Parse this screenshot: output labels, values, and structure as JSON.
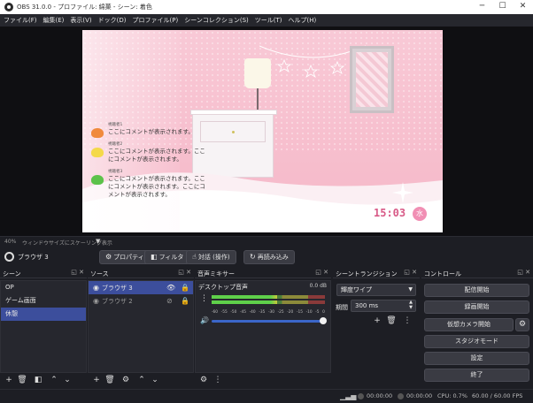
{
  "window": {
    "title": "OBS 31.0.0 - プロファイル: 綿菓 - シーン: 着色",
    "minimize": "─",
    "maximize": "☐",
    "close": "✕"
  },
  "menu": [
    "ファイル(F)",
    "編集(E)",
    "表示(V)",
    "ドック(D)",
    "プロファイル(P)",
    "シーンコレクション(S)",
    "ツール(T)",
    "ヘルプ(H)"
  ],
  "preview": {
    "comments": [
      {
        "name": "視聴者1",
        "msg": "ここにコメントが表示されます。",
        "color": "#f08a3c"
      },
      {
        "name": "視聴者2",
        "msg": "ここにコメントが表示されます。ここにコメントが表示されます。",
        "color": "#f4d94a"
      },
      {
        "name": "視聴者3",
        "msg": "ここにコメントが表示されます。ここにコメントが表示されます。ここにコメントが表示されます。",
        "color": "#5cc24a"
      }
    ],
    "clock": "15:03",
    "clock_day": "水"
  },
  "scale": {
    "zoom": "40%",
    "mode": "ウィンドウサイズにスケーリング表示",
    "caret": "▼"
  },
  "source_toolbar": {
    "source_name": "ブラウザ 3",
    "properties": "プロパティ",
    "filters": "フィルタ",
    "interact": "対話 (操作)",
    "refresh": "再読み込み"
  },
  "scenes": {
    "title": "シーン",
    "items": [
      {
        "label": "OP",
        "selected": false
      },
      {
        "label": "ゲーム画面",
        "selected": false
      },
      {
        "label": "休憩",
        "selected": true
      }
    ]
  },
  "sources": {
    "title": "ソース",
    "items": [
      {
        "label": "ブラウザ 3",
        "selected": true,
        "visible": true
      },
      {
        "label": "ブラウザ 2",
        "selected": false,
        "visible": false
      }
    ]
  },
  "mixer": {
    "title": "音声ミキサー",
    "track_name": "デスクトップ音声",
    "db_value": "0.0 dB",
    "meter_level": 0.58,
    "volume": 1.0,
    "ticks": [
      "-60",
      "-55",
      "-50",
      "-45",
      "-40",
      "-35",
      "-30",
      "-25",
      "-20",
      "-15",
      "-10",
      "-5",
      "0"
    ]
  },
  "transitions": {
    "title": "シーントランジション",
    "selected": "輝度ワイプ",
    "duration_label": "期間",
    "duration": "300 ms"
  },
  "controls": {
    "title": "コントロール",
    "start_stream": "配信開始",
    "start_record": "録画開始",
    "start_vcam": "仮想カメラ開始",
    "studio_mode": "スタジオモード",
    "settings": "設定",
    "exit": "終了"
  },
  "status": {
    "stream_time": "00:00:00",
    "record_time": "00:00:00",
    "cpu": "CPU: 0.7%",
    "fps": "60.00 / 60.00 FPS"
  },
  "colors": {
    "accent": "#3c4e9c",
    "background": "#1d1e24",
    "panel": "#26272e"
  }
}
